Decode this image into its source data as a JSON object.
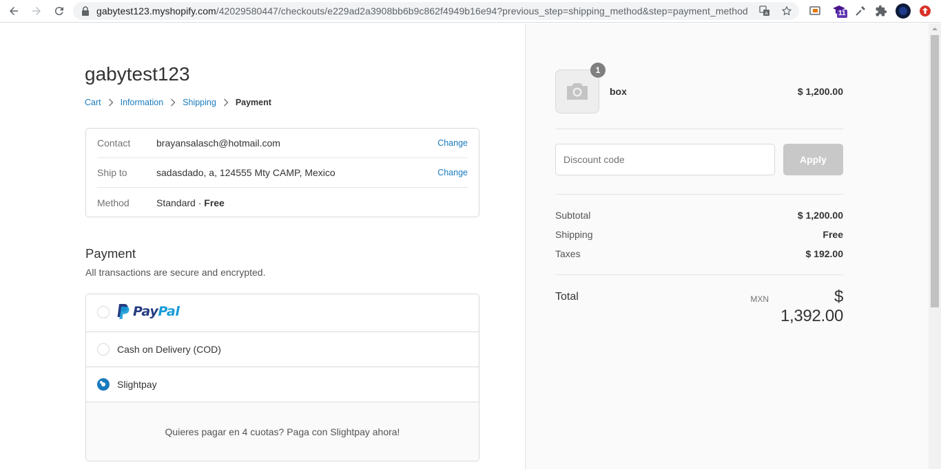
{
  "browser": {
    "url_host": "gabytest123.myshopify.com",
    "url_path": "/42029580447/checkouts/e229ad2a3908bb6b9c862f4949b16e94?previous_step=shipping_method&step=payment_method",
    "extension_badge": "11"
  },
  "header": {
    "store_name": "gabytest123"
  },
  "breadcrumb": {
    "items": [
      "Cart",
      "Information",
      "Shipping"
    ],
    "current": "Payment"
  },
  "review": {
    "rows": [
      {
        "label": "Contact",
        "value": "brayansalasch@hotmail.com",
        "action": "Change"
      },
      {
        "label": "Ship to",
        "value": "sadasdado, a, 124555 Mty CAMP, Mexico",
        "action": "Change"
      },
      {
        "label": "Method",
        "value": "Standard · ",
        "value_bold": "Free"
      }
    ]
  },
  "payment": {
    "title": "Payment",
    "subtitle": "All transactions are secure and encrypted.",
    "paypal": {
      "pay": "Pay",
      "pal": "Pal"
    },
    "methods": [
      {
        "label": "Cash on Delivery (COD)",
        "selected": false
      },
      {
        "label": "Slightpay",
        "selected": true
      }
    ],
    "description": "Quieres pagar en 4 cuotas? Paga con Slightpay ahora!"
  },
  "summary": {
    "product": {
      "name": "box",
      "price": "$ 1,200.00",
      "quantity": "1"
    },
    "discount": {
      "placeholder": "Discount code",
      "button": "Apply"
    },
    "lines": [
      {
        "label": "Subtotal",
        "value": "$ 1,200.00"
      },
      {
        "label": "Shipping",
        "value": "Free"
      },
      {
        "label": "Taxes",
        "value": "$ 192.00"
      }
    ],
    "total": {
      "label": "Total",
      "currency": "MXN",
      "value": "$ 1,392.00"
    }
  },
  "colors": {
    "accent": "#197bbd",
    "paypal_dark": "#253b80",
    "paypal_light": "#179bd7"
  }
}
